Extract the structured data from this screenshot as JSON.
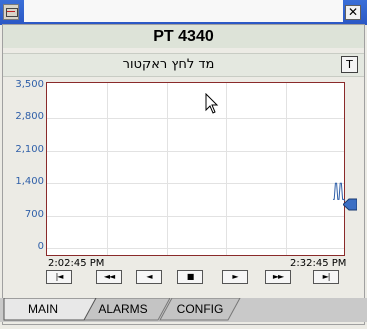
{
  "window": {
    "tag": "PT 4340",
    "description": "מד לחץ ראקטור",
    "close_glyph": "✕",
    "trend_button_label": "T"
  },
  "chart_data": {
    "type": "line",
    "y_ticks": [
      "3,500",
      "2,800",
      "2,100",
      "1,400",
      "700",
      "0"
    ],
    "ylim": [
      0,
      3500
    ],
    "x_start_label": "2:02:45 PM",
    "x_end_label": "2:32:45 PM",
    "grid": true,
    "series": [
      {
        "values": [
          1050,
          1050,
          1400,
          1400,
          1050,
          1050,
          1400,
          1400,
          1050,
          1050,
          1020
        ]
      }
    ],
    "line_color": "#2f5fa8"
  },
  "navigation": {
    "buttons": [
      {
        "id": "first",
        "label": "|◄"
      },
      {
        "id": "fast-back",
        "label": "◄◄"
      },
      {
        "id": "back",
        "label": "◄"
      },
      {
        "id": "stop",
        "label": "■"
      },
      {
        "id": "forward",
        "label": "►"
      },
      {
        "id": "fast-forward",
        "label": "►►"
      },
      {
        "id": "last",
        "label": "►|"
      }
    ]
  },
  "tabs": [
    {
      "label": "MAIN",
      "active": true
    },
    {
      "label": "ALARMS",
      "active": false
    },
    {
      "label": "CONFIG",
      "active": false
    }
  ]
}
